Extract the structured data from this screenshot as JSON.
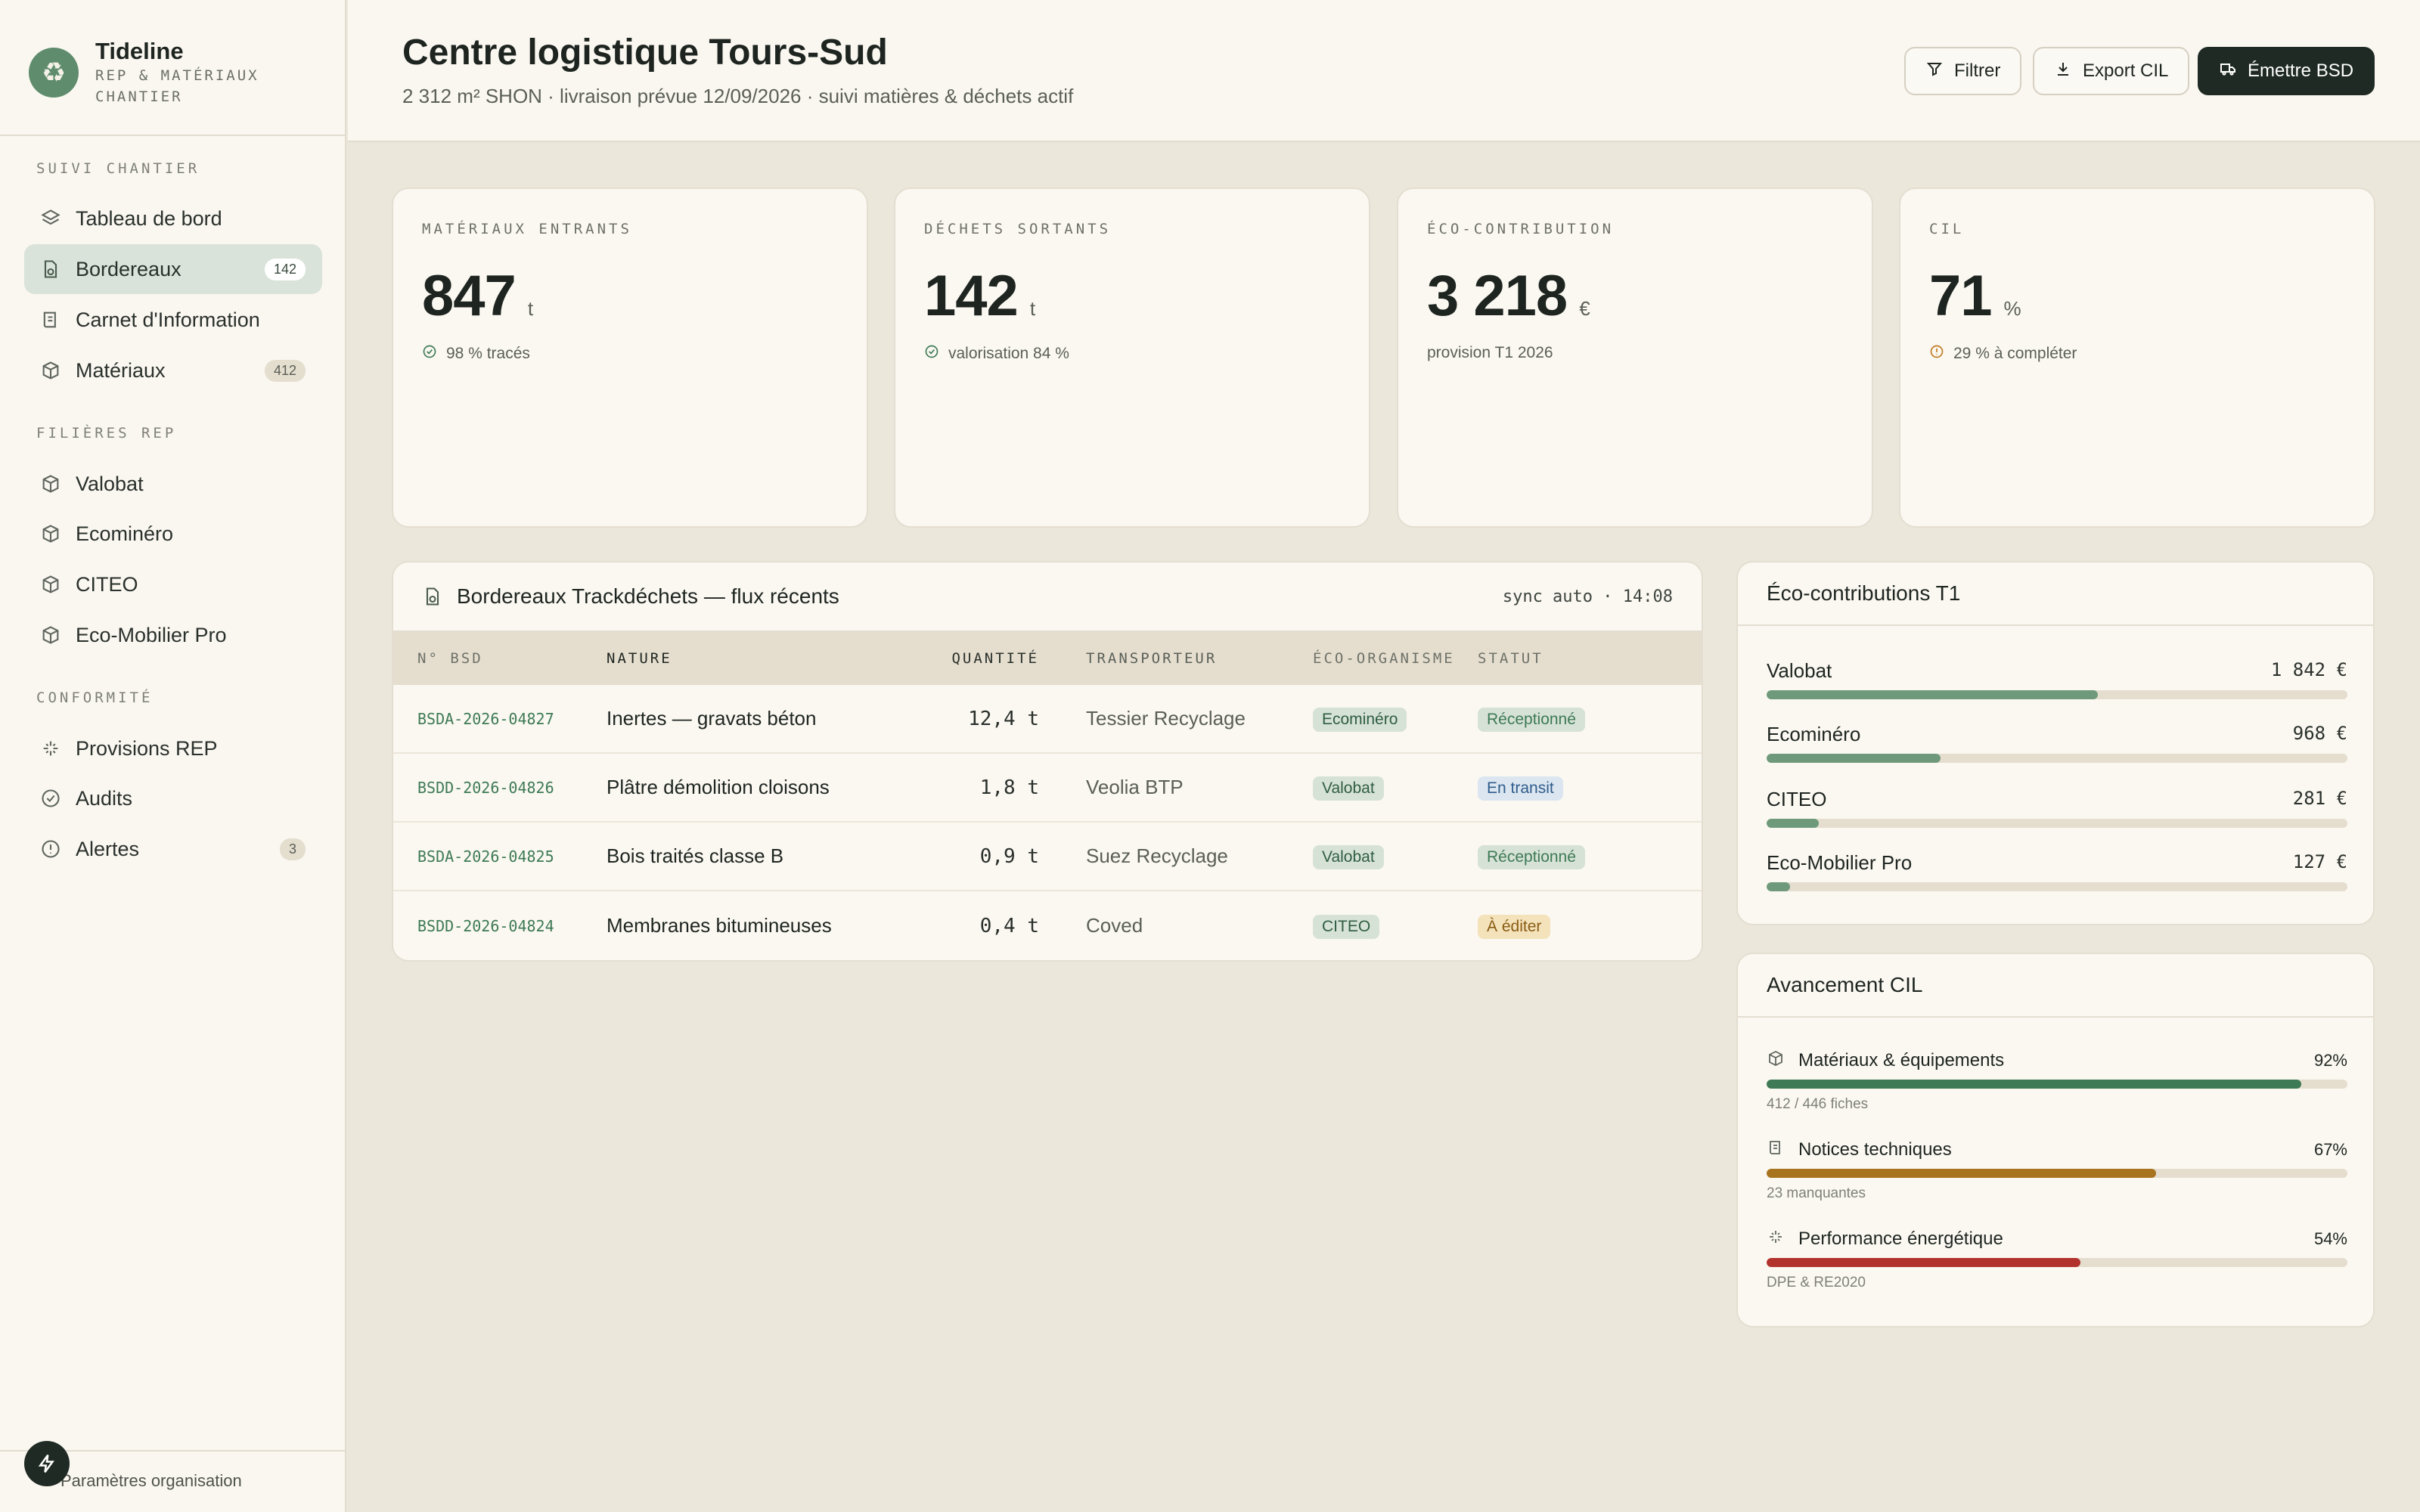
{
  "brand": {
    "name": "Tideline",
    "subtitle_line1": "REP & MATÉRIAUX",
    "subtitle_line2": "CHANTIER"
  },
  "sidebar": {
    "sections": [
      {
        "label": "SUIVI CHANTIER"
      },
      {
        "label": "FILIÈRES REP"
      },
      {
        "label": "CONFORMITÉ"
      }
    ],
    "items": [
      {
        "label": "Tableau de bord",
        "icon": "layers-icon"
      },
      {
        "label": "Bordereaux",
        "icon": "document-recycle-icon",
        "count": "142",
        "active": true
      },
      {
        "label": "Carnet d'Information",
        "icon": "notebook-icon"
      },
      {
        "label": "Matériaux",
        "icon": "cube-icon",
        "count": "412"
      },
      {
        "label": "Valobat",
        "icon": "cube-icon"
      },
      {
        "label": "Ecominéro",
        "icon": "cube-icon"
      },
      {
        "label": "CITEO",
        "icon": "cube-icon"
      },
      {
        "label": "Eco-Mobilier Pro",
        "icon": "cube-icon"
      },
      {
        "label": "Provisions REP",
        "icon": "sparkle-icon"
      },
      {
        "label": "Audits",
        "icon": "check-circle-icon"
      },
      {
        "label": "Alertes",
        "icon": "alert-circle-icon",
        "count": "3"
      }
    ],
    "footer": {
      "settings_label": "Paramètres organisation"
    }
  },
  "header": {
    "title": "Centre logistique Tours-Sud",
    "subtitle": "2 312 m² SHON · livraison prévue 12/09/2026 · suivi matières & déchets actif",
    "buttons": {
      "filter": "Filtrer",
      "export": "Export CIL",
      "emit": "Émettre BSD"
    }
  },
  "kpis": [
    {
      "label": "MATÉRIAUX ENTRANTS",
      "value": "847",
      "unit": "t",
      "note": "98 % tracés",
      "note_icon": "check-circle-icon"
    },
    {
      "label": "DÉCHETS SORTANTS",
      "value": "142",
      "unit": "t",
      "note": "valorisation 84 %",
      "note_icon": "check-circle-icon"
    },
    {
      "label": "ÉCO-CONTRIBUTION",
      "value": "3 218",
      "unit": "€",
      "note": "provision T1 2026",
      "note_icon": ""
    },
    {
      "label": "CIL",
      "value": "71",
      "unit": "%",
      "note": "29 % à compléter",
      "note_icon": "alert-circle-icon"
    }
  ],
  "bordereaux": {
    "title": "Bordereaux Trackdéchets — flux récents",
    "sync": "sync auto · 14:08",
    "columns": [
      "N° BSD",
      "NATURE",
      "QUANTITÉ",
      "TRANSPORTEUR",
      "ÉCO-ORGANISME",
      "STATUT"
    ],
    "rows": [
      {
        "id": "BSDA-2026-04827",
        "nature": "Inertes — gravats béton",
        "qty": "12,4 t",
        "carrier": "Tessier Recyclage",
        "org": "Ecominéro",
        "status": "Réceptionné",
        "status_kind": "ok"
      },
      {
        "id": "BSDD-2026-04826",
        "nature": "Plâtre démolition cloisons",
        "qty": "1,8 t",
        "carrier": "Veolia BTP",
        "org": "Valobat",
        "status": "En transit",
        "status_kind": "transit"
      },
      {
        "id": "BSDA-2026-04825",
        "nature": "Bois traités classe B",
        "qty": "0,9 t",
        "carrier": "Suez Recyclage",
        "org": "Valobat",
        "status": "Réceptionné",
        "status_kind": "ok"
      },
      {
        "id": "BSDD-2026-04824",
        "nature": "Membranes bitumineuses",
        "qty": "0,4 t",
        "carrier": "Coved",
        "org": "CITEO",
        "status": "À éditer",
        "status_kind": "edit"
      }
    ]
  },
  "eco_contributions": {
    "title": "Éco-contributions T1",
    "items": [
      {
        "name": "Valobat",
        "amount": "1 842 €",
        "share": 0.57,
        "color": "#6E9A7B"
      },
      {
        "name": "Ecominéro",
        "amount": "968 €",
        "share": 0.3,
        "color": "#6E9A7B"
      },
      {
        "name": "CITEO",
        "amount": "281 €",
        "share": 0.09,
        "color": "#6E9A7B"
      },
      {
        "name": "Eco-Mobilier Pro",
        "amount": "127 €",
        "share": 0.04,
        "color": "#6E9A7B"
      }
    ]
  },
  "cil_progress": {
    "title": "Avancement CIL",
    "items": [
      {
        "name": "Matériaux & équipements",
        "pct": "92%",
        "value": 0.92,
        "sub": "412 / 446 fiches",
        "icon": "cube-icon",
        "color": "#3D7A55"
      },
      {
        "name": "Notices techniques",
        "pct": "67%",
        "value": 0.67,
        "sub": "23 manquantes",
        "icon": "notebook-icon",
        "color": "#A8731F"
      },
      {
        "name": "Performance énergétique",
        "pct": "54%",
        "value": 0.54,
        "sub": "DPE & RE2020",
        "icon": "sparkle-icon",
        "color": "#B2322D"
      }
    ]
  }
}
